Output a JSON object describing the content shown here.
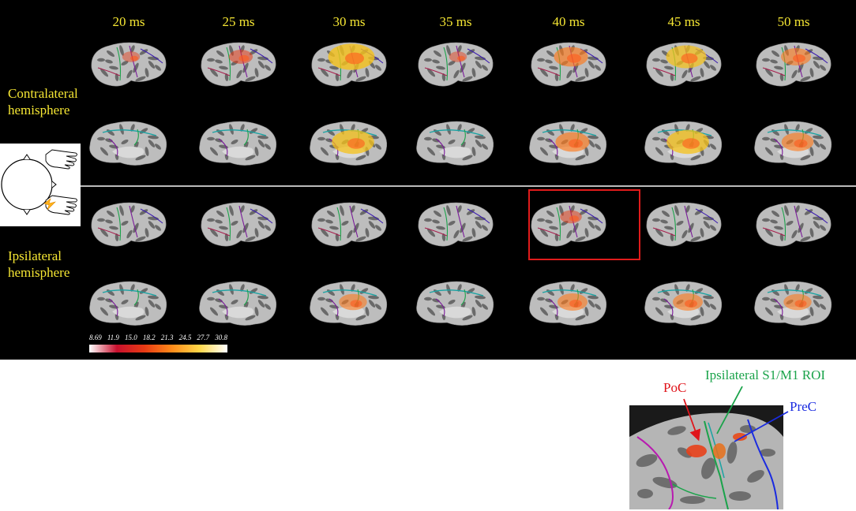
{
  "time_labels": [
    "20 ms",
    "25 ms",
    "30 ms",
    "35 ms",
    "40 ms",
    "45 ms",
    "50 ms"
  ],
  "hemisphere_labels": {
    "contralateral_line1": "Contralateral",
    "contralateral_line2": "hemisphere",
    "ipsilateral_line1": "Ipsilateral",
    "ipsilateral_line2": "hemisphere"
  },
  "colorbar": {
    "ticks": [
      "8.69",
      "11.9",
      "15.0",
      "18.2",
      "21.3",
      "24.5",
      "27.7",
      "30.8"
    ]
  },
  "inset_labels": {
    "roi": "Ipsilateral S1/M1 ROI",
    "poc": "PoC",
    "prec": "PreC"
  },
  "colors": {
    "label_yellow": "#f5e633",
    "highlight_red": "#e01b1b",
    "roi_green": "#1aa34a",
    "poc_red": "#e0151b",
    "prec_blue": "#1a2be0"
  },
  "activation_levels": {
    "contra_lateral": [
      0.2,
      0.35,
      0.9,
      0.2,
      0.6,
      0.75,
      0.5
    ],
    "contra_medial": [
      0.0,
      0.0,
      0.8,
      0.0,
      0.6,
      0.8,
      0.55
    ],
    "ipsi_lateral": [
      0.0,
      0.0,
      0.0,
      0.0,
      0.3,
      0.0,
      0.0
    ],
    "ipsi_medial": [
      0.0,
      0.0,
      0.45,
      0.0,
      0.5,
      0.5,
      0.45
    ]
  }
}
